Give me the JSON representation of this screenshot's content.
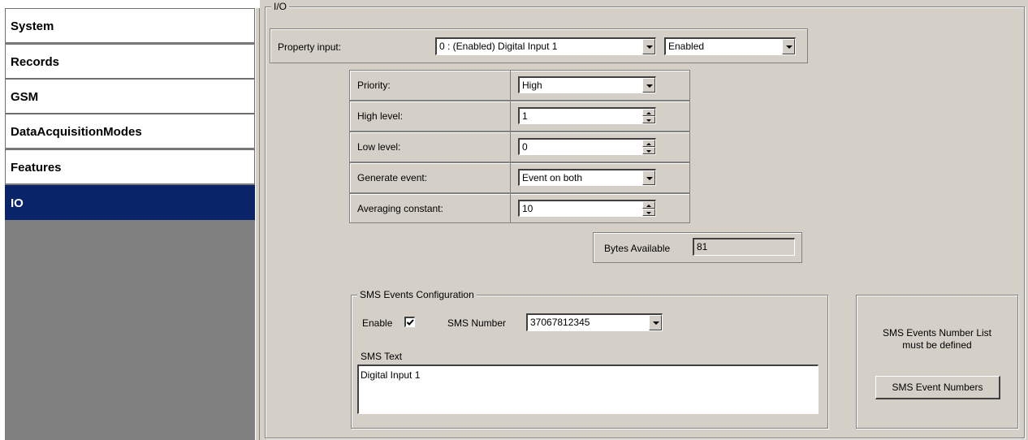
{
  "sidebar": {
    "items": [
      {
        "label": "System"
      },
      {
        "label": "Records"
      },
      {
        "label": "GSM"
      },
      {
        "label": "DataAcquisitionModes"
      },
      {
        "label": "Features"
      },
      {
        "label": "IO"
      }
    ],
    "active": "IO"
  },
  "io_group": {
    "title": "I/O",
    "property_input": {
      "label": "Property input:",
      "input_value": "0 : (Enabled) Digital Input 1",
      "state_value": "Enabled"
    },
    "params": {
      "priority": {
        "label": "Priority:",
        "value": "High"
      },
      "high_level": {
        "label": "High level:",
        "value": "1"
      },
      "low_level": {
        "label": "Low level:",
        "value": "0"
      },
      "generate_event": {
        "label": "Generate event:",
        "value": "Event on both"
      },
      "averaging_constant": {
        "label": "Averaging constant:",
        "value": "10"
      }
    },
    "bytes_available": {
      "label": "Bytes Available",
      "value": "81"
    }
  },
  "sms_config": {
    "title": "SMS Events Configuration",
    "enable_label": "Enable",
    "enable_checked": true,
    "sms_number_label": "SMS Number",
    "sms_number_value": "37067812345",
    "sms_text_label": "SMS Text",
    "sms_text_value": "Digital Input 1"
  },
  "sms_numbers_panel": {
    "message_line1": "SMS Events Number List",
    "message_line2": "must be defined",
    "button_label": "SMS Event Numbers"
  },
  "colors": {
    "sidebar_active_bg": "#0a246a",
    "sidebar_bg": "#808080",
    "panel_bg": "#d4d0c8"
  }
}
